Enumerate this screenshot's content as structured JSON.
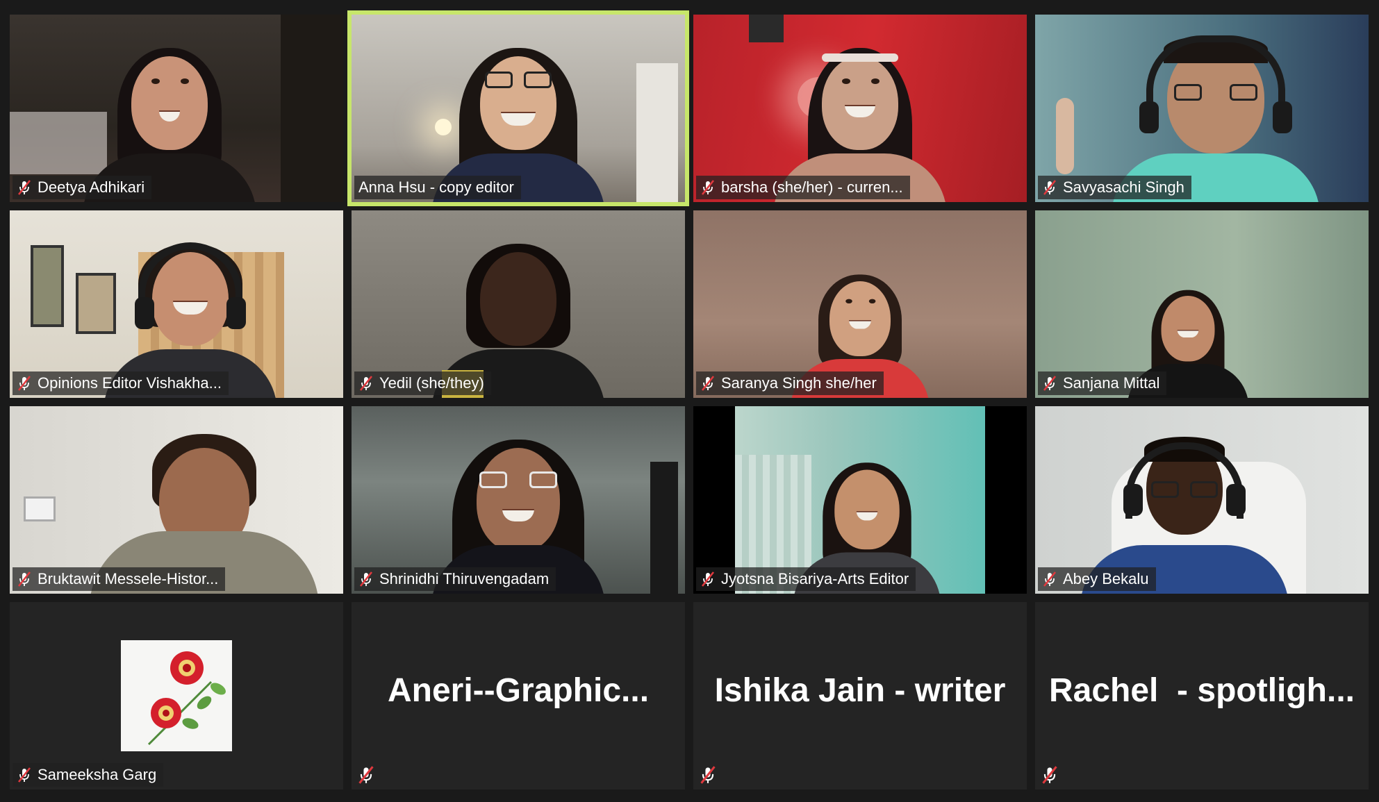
{
  "participants": [
    {
      "name": "Deetya Adhikari",
      "muted": true
    },
    {
      "name": "Anna Hsu - copy editor",
      "muted": false,
      "speaking": true
    },
    {
      "name": "barsha (she/her) - curren...",
      "muted": true
    },
    {
      "name": "Savyasachi Singh",
      "muted": true
    },
    {
      "name": "Opinions Editor Vishakha...",
      "muted": true
    },
    {
      "name": "Yedil (she/they)",
      "muted": true
    },
    {
      "name": "Saranya Singh she/her",
      "muted": true
    },
    {
      "name": "Sanjana Mittal",
      "muted": true
    },
    {
      "name": "Bruktawit Messele-Histor...",
      "muted": true
    },
    {
      "name": "Shrinidhi Thiruvengadam",
      "muted": true
    },
    {
      "name": "Jyotsna Bisariya-Arts Editor",
      "muted": true
    },
    {
      "name": "Abey Bekalu",
      "muted": true
    },
    {
      "name": "Sameeksha Garg",
      "muted": true,
      "video": "off",
      "avatar": "red-flowers"
    },
    {
      "name": "Aneri--Graphic...",
      "muted": true,
      "video": "off"
    },
    {
      "name": "Ishika Jain - writer",
      "muted": true,
      "video": "off"
    },
    {
      "name": "Rachel  - spotligh...",
      "muted": true,
      "video": "off"
    }
  ],
  "colors": {
    "background": "#1a1a1a",
    "tile": "#242424",
    "speaking_border": "#c7e66a",
    "muted_icon": "#e0393e"
  },
  "icons": {
    "muted": "mic-muted-icon"
  }
}
